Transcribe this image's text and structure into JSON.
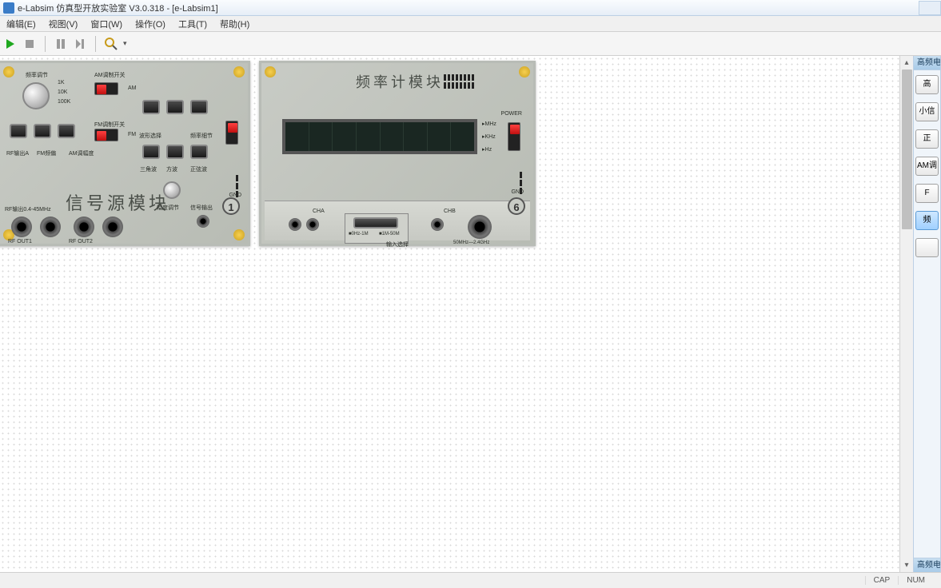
{
  "app": {
    "title": " e-Labsim 仿真型开放实验室 V3.0.318 - [e-Labsim1]"
  },
  "menu": {
    "edit": "编辑(E)",
    "view": "视图(V)",
    "window": "窗口(W)",
    "operate": "操作(O)",
    "tool": "工具(T)",
    "help": "帮助(H)"
  },
  "status": {
    "cap": "CAP",
    "num": "NUM"
  },
  "right_panel": {
    "header": "高频电子",
    "buttons": [
      "高",
      "小信",
      "正",
      "AM调",
      "F",
      "频",
      ""
    ],
    "active_index": 5,
    "footer": "高频电"
  },
  "module1": {
    "title": "信号源模块",
    "badge": "1",
    "labels": {
      "freq_adj": "频率调节",
      "am_mod_sw": "AM调制开关",
      "k1": "1K",
      "k10": "10K",
      "k100": "100K",
      "am": "AM",
      "fm_mod_sw": "FM调制开关",
      "fm": "FM",
      "wave_sel": "波形选择",
      "freq_fine": "频率细节",
      "rf_out_a": "RF输出A",
      "fm_out": "FM频偏",
      "am_amp": "AM调幅度",
      "tri": "三角波",
      "square": "方波",
      "sine": "正弦波",
      "gnd": "GND",
      "rf_rng": "RF输出0.4-45MHz",
      "rf_out1": "RF OUT1",
      "rf_out2": "RF OUT2",
      "amp_adj": "幅度调节",
      "sig_out": "信号输出"
    }
  },
  "module6": {
    "title": "频率计模块",
    "badge": "6",
    "labels": {
      "mhz": "MHz",
      "khz": "KHz",
      "hz": "Hz",
      "power": "POWER",
      "gnd": "GND",
      "cha": "CHA",
      "chb": "CHB",
      "rng_low": "0Hz-1M",
      "rng_high": "1M-50M",
      "input_sel": "输入选择",
      "rng_rf": "50MHz—2.4GHz"
    }
  }
}
